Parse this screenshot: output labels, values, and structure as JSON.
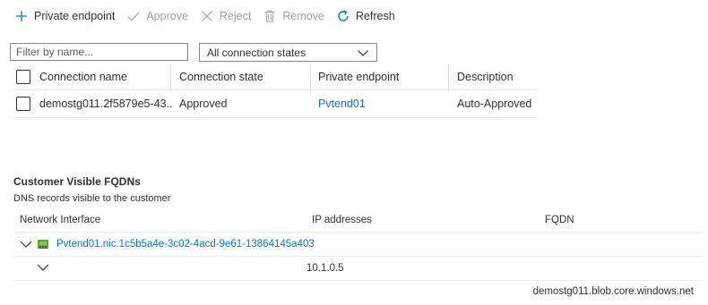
{
  "toolbar": {
    "private_endpoint": "Private endpoint",
    "approve": "Approve",
    "reject": "Reject",
    "remove": "Remove",
    "refresh": "Refresh"
  },
  "filters": {
    "name_placeholder": "Filter by name...",
    "state_selected": "All connection states"
  },
  "connections": {
    "columns": [
      "Connection name",
      "Connection state",
      "Private endpoint",
      "Description"
    ],
    "rows": [
      {
        "name": "demostg011.2f5879e5-43...",
        "state": "Approved",
        "endpoint": "Pvtend01",
        "description": "Auto-Approved"
      }
    ]
  },
  "fqdn_section": {
    "title": "Customer Visible FQDNs",
    "subtitle": "DNS records visible to the customer",
    "columns": [
      "Network Interface",
      "IP addresses",
      "FQDN"
    ],
    "nic_name": "Pvtend01.nic.1c5b5a4e-3c02-4acd-9e61-13864145a403",
    "ip_address": "10.1.0.5",
    "fqdn_value": "demostg011.blob.core.windows.net"
  },
  "colors": {
    "accent": "#0078d4",
    "disabled": "#a19f9d",
    "text": "#323130"
  }
}
